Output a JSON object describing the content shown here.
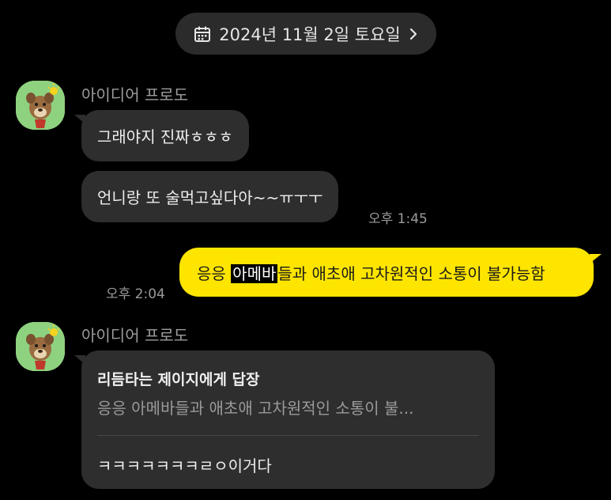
{
  "date_divider": {
    "label": "2024년 11월 2일 토요일",
    "icon": "calendar-icon",
    "chevron": "chevron-right-icon"
  },
  "colors": {
    "background": "#000000",
    "bubble_other": "#2e2e2e",
    "bubble_mine": "#fee500",
    "avatar_bg": "#8ed27f"
  },
  "messages": [
    {
      "sender": "아이디어 프로도",
      "text": "그래야지 진짜ㅎㅎㅎ"
    },
    {
      "text": "언니랑 또 술먹고싶다아~~ㅠㅜㅜ",
      "time": "오후 1:45"
    },
    {
      "mine": true,
      "text_before": "응응 ",
      "highlight": "아메바",
      "text_after": "들과 애초애 고차원적인 소통이 불가능함",
      "time": "오후 2:04"
    },
    {
      "sender": "아이디어 프로도",
      "reply_title": "리듬타는 제이지에게 답장",
      "reply_quote": "응응 아메바들과 애초애 고차원적인 소통이 불...",
      "text": "ㅋㅋㅋㅋㅋㅋㅋㄹㅇ이거다"
    }
  ]
}
